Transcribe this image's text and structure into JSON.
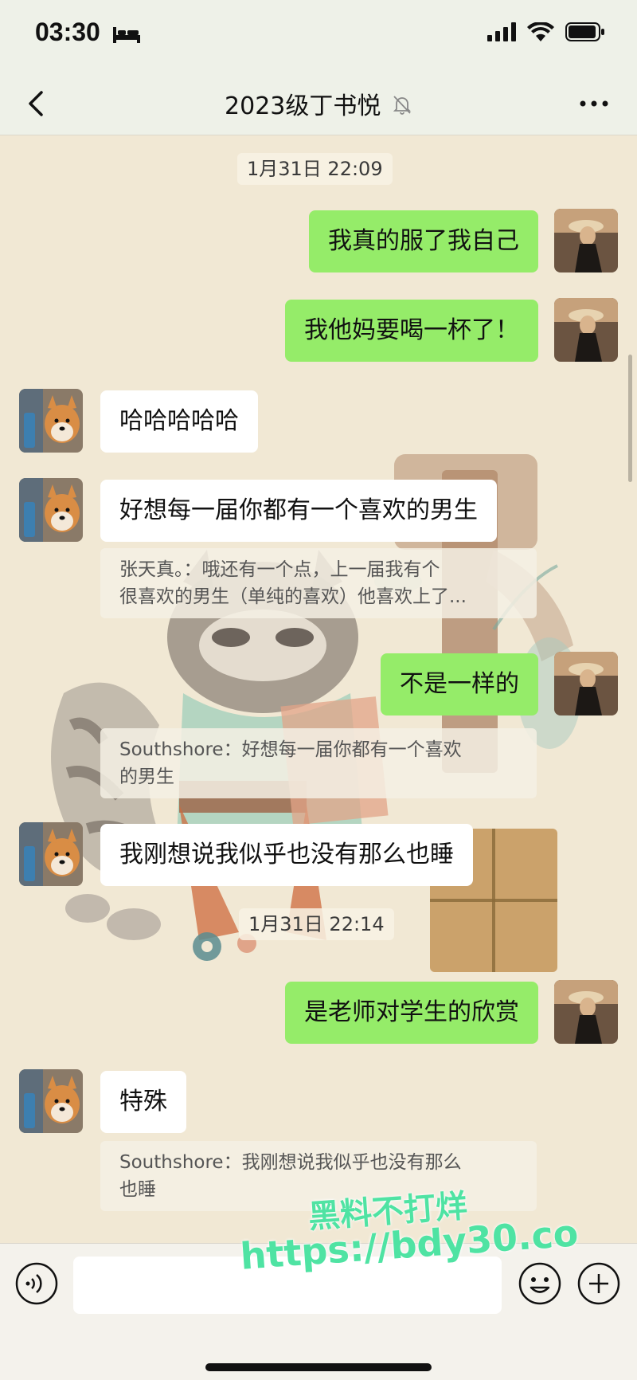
{
  "status_bar": {
    "time": "03:30"
  },
  "nav": {
    "title": "2023级丁书悦"
  },
  "chat": {
    "timestamps": [
      "1月31日 22:09",
      "1月31日 22:14"
    ],
    "messages": {
      "m1": "我真的服了我自己",
      "m2": "我他妈要喝一杯了！",
      "m3": "哈哈哈哈哈",
      "m4": "好想每一届你都有一个喜欢的男生",
      "m4_quote_line1": "张天真。：哦还有一个点，上一届我有个",
      "m4_quote_line2": "很喜欢的男生（单纯的喜欢）他喜欢上了...",
      "m5": "不是一样的",
      "m5_quote_line1": "Southshore：好想每一届你都有一个喜欢",
      "m5_quote_line2": "的男生",
      "m6": "我刚想说我似乎也没有那么也睡",
      "m7": "是老师对学生的欣赏",
      "m8": "特殊",
      "m8_quote_line1": "Southshore：我刚想说我似乎也没有那么",
      "m8_quote_line2": "也睡"
    }
  },
  "input": {
    "value": ""
  },
  "watermark": {
    "line1": "黑料不打烊",
    "line2": "https://bdy30.co"
  },
  "colors": {
    "sent_bubble": "#95ec69",
    "recv_bubble": "#ffffff",
    "watermark": "#4fe3a3"
  }
}
